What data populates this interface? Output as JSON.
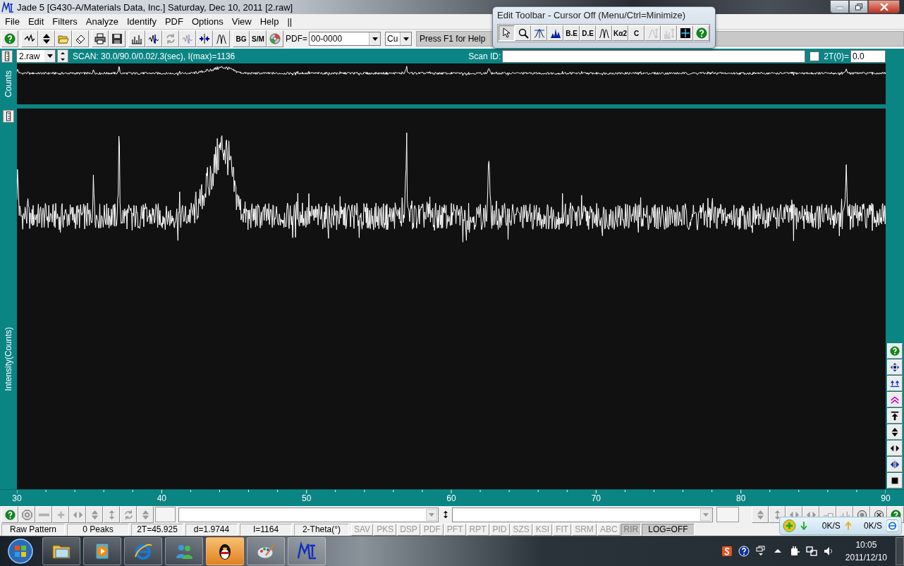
{
  "window": {
    "title": "Jade 5 [G430-A/Materials Data, Inc.] Saturday, Dec 10, 2011 [2.raw]"
  },
  "menu": [
    "File",
    "Edit",
    "Filters",
    "Analyze",
    "Identify",
    "PDF",
    "Options",
    "View",
    "Help",
    "||"
  ],
  "toolbar": {
    "buttons": [
      {
        "disabled": false
      },
      {
        "disabled": false
      },
      {
        "disabled": false
      },
      {
        "disabled": false
      },
      {
        "disabled": false
      },
      {
        "disabled": false
      },
      {
        "disabled": false
      },
      {
        "disabled": false
      },
      {
        "disabled": false
      },
      {
        "disabled": true
      },
      {
        "disabled": true
      },
      {
        "disabled": false
      },
      {
        "disabled": false
      },
      {
        "label": "BG",
        "disabled": false
      },
      {
        "label": "S/M",
        "disabled": false
      },
      {
        "disabled": false
      }
    ],
    "pdf_label": "PDF=",
    "pdf_value": "00-0000",
    "radiation": "Cu",
    "hint": "Press F1 for Help"
  },
  "scan": {
    "file": "2.raw",
    "info": "SCAN: 30.0/90.0/0.02/.3(sec), I(max)=1136",
    "id_label": "Scan ID:",
    "offset": {
      "checked": false,
      "label": "2T(0)=",
      "value": "0.0"
    }
  },
  "plots": {
    "overview_ylabel": "Counts",
    "ylabel": "Intensity(Counts)",
    "x_labels": [
      "30",
      "40",
      "50",
      "60",
      "70",
      "80",
      "90"
    ]
  },
  "bottom_toolbar": {
    "left": [
      {
        "disabled": false
      },
      {
        "disabled": false
      },
      {
        "disabled": true
      },
      {
        "disabled": true
      },
      {
        "disabled": true
      },
      {
        "disabled": true
      },
      {
        "disabled": true
      },
      {
        "disabled": true
      },
      {
        "disabled": true
      }
    ],
    "right": [
      {
        "disabled": true
      },
      {
        "disabled": true
      },
      {
        "disabled": true
      },
      {
        "disabled": true
      },
      {
        "disabled": true
      },
      {
        "disabled": true
      },
      {
        "disabled": false
      },
      {
        "disabled": false
      },
      {
        "disabled": false
      }
    ]
  },
  "status": {
    "cells": [
      "Raw Pattern",
      "0 Peaks",
      "2T=45.925",
      "d=1.9744",
      "I=1164",
      "2-Theta(°)"
    ],
    "buttons": [
      {
        "label": "SAV",
        "pressed": false
      },
      {
        "label": "PKS",
        "pressed": false
      },
      {
        "label": "DSP",
        "pressed": false
      },
      {
        "label": "PDF",
        "pressed": false
      },
      {
        "label": "PFT",
        "pressed": false
      },
      {
        "label": "RPT",
        "pressed": false
      },
      {
        "label": "PID",
        "pressed": false
      },
      {
        "label": "SZS",
        "pressed": false
      },
      {
        "label": "KSI",
        "pressed": false
      },
      {
        "label": "FIT",
        "pressed": false
      },
      {
        "label": "SRM",
        "pressed": false
      },
      {
        "label": "ABC",
        "pressed": false
      },
      {
        "label": "RIR",
        "pressed": true
      },
      {
        "label": "LOG=OFF",
        "pressed": true
      }
    ]
  },
  "edit_toolbar": {
    "title": "Edit Toolbar - Cursor Off (Menu/Ctrl=Minimize)",
    "buttons": [
      {
        "selected": true,
        "disabled": false
      },
      {
        "selected": false,
        "disabled": false
      },
      {
        "selected": false,
        "disabled": false
      },
      {
        "selected": false,
        "disabled": false
      },
      {
        "label": "B.E",
        "selected": false,
        "disabled": false
      },
      {
        "label": "D.E",
        "selected": false,
        "disabled": false
      },
      {
        "selected": false,
        "disabled": false
      },
      {
        "label": "Kα2",
        "selected": false,
        "disabled": false
      },
      {
        "label": "C",
        "selected": false,
        "disabled": false
      },
      {
        "selected": false,
        "disabled": true
      },
      {
        "selected": false,
        "disabled": true
      },
      {
        "selected": false,
        "disabled": false
      },
      {
        "selected": false,
        "disabled": false
      }
    ]
  },
  "network": {
    "down": "0K/S",
    "up": "0K/S"
  },
  "taskbar": {
    "apps": [
      {
        "active": false
      },
      {
        "active": false
      },
      {
        "active": false
      },
      {
        "active": false
      },
      {
        "active": true
      },
      {
        "active": false
      },
      {
        "active": false
      }
    ],
    "time": "10:05",
    "date": "2011/12/10"
  }
}
